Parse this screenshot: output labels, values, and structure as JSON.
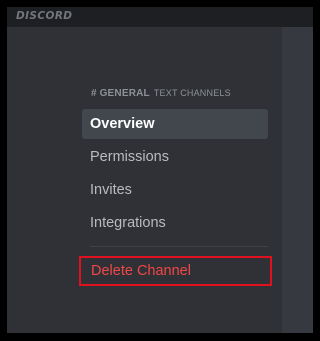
{
  "app": {
    "logo_text": "DISCORD"
  },
  "settings_menu": {
    "header": {
      "hash": "#",
      "channel_name": "GENERAL",
      "section_label": "TEXT CHANNELS"
    },
    "items": [
      {
        "label": "Overview",
        "selected": true
      },
      {
        "label": "Permissions",
        "selected": false
      },
      {
        "label": "Invites",
        "selected": false
      },
      {
        "label": "Integrations",
        "selected": false
      }
    ],
    "danger_item": {
      "label": "Delete Channel"
    }
  },
  "colors": {
    "sidebar_bg": "#2f3136",
    "content_bg": "#36393f",
    "selected_bg": "#42464d",
    "danger_text": "#f04747",
    "highlight_border": "#e0101e"
  }
}
